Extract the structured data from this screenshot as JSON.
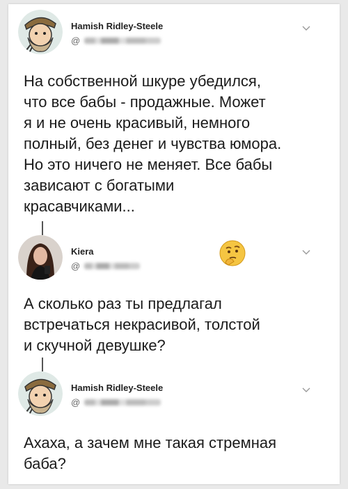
{
  "tweets": [
    {
      "author": "Hamish Ridley-Steele",
      "handle_prefix": "@",
      "text": "На собственной шкуре убедился,\nчто все бабы - продажные. Может\nя и не очень красивый, немного\nполный, без денег и чувства юмора.\nНо это ничего не меняет. Все бабы\nзависают с богатыми\nкрасавчиками..."
    },
    {
      "author": "Kiera",
      "handle_prefix": "@",
      "text": "А сколько раз ты предлагал\nвстречаться некрасивой, толстой\nи скучной девушке?",
      "emoji": "thinking-face"
    },
    {
      "author": "Hamish Ridley-Steele",
      "handle_prefix": "@",
      "text": "Ахаха, а зачем мне такая стремная\nбаба?"
    }
  ],
  "colors": {
    "background": "#e9e9e9",
    "card": "#ffffff",
    "text": "#1b1b1b",
    "handle": "#666666"
  }
}
